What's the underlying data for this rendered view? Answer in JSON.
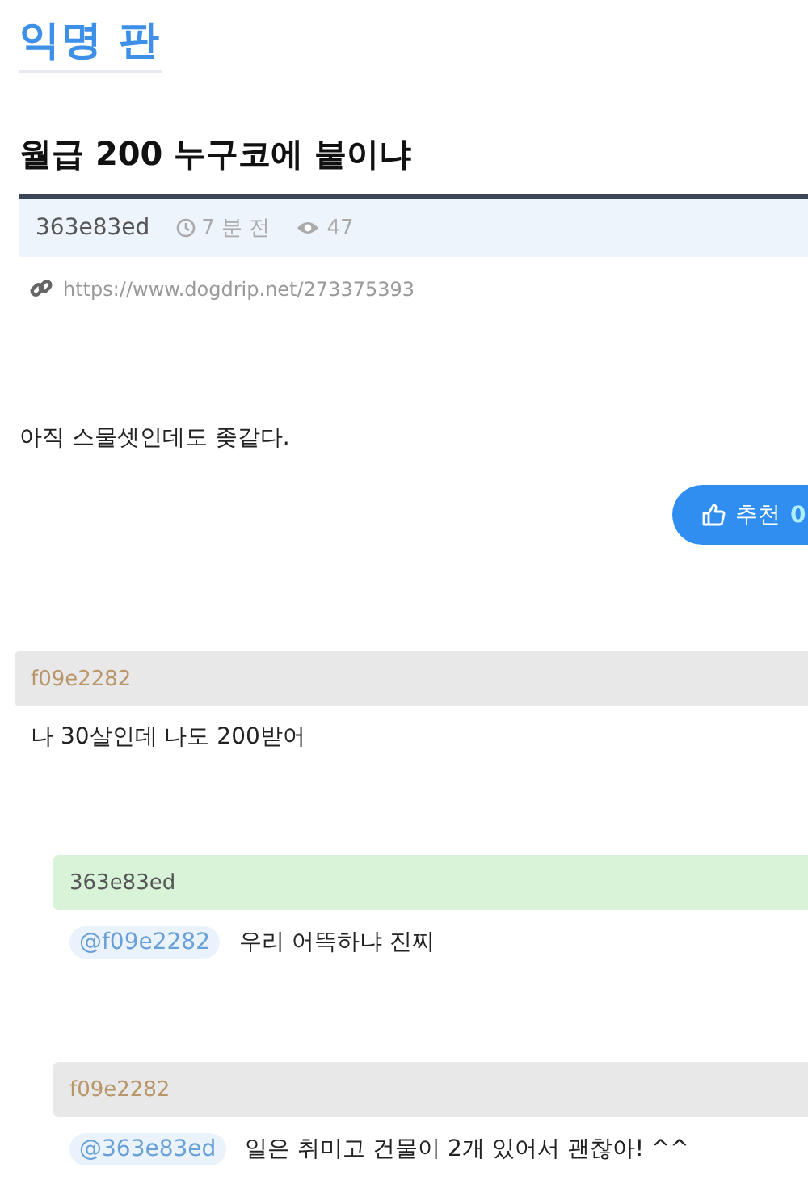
{
  "board": {
    "title": "익명 판"
  },
  "post": {
    "title": "월급 200 누구코에 붙이냐",
    "author": "363e83ed",
    "time": "7 분 전",
    "views": "47",
    "link": "https://www.dogdrip.net/273375393",
    "body": "아직 스물셋인데도 좆같다.",
    "recommend": {
      "label": "추천",
      "count": "0"
    }
  },
  "comments": [
    {
      "author": "f09e2282",
      "is_author": false,
      "text": "나 30살인데 나도 200받어",
      "children": [
        {
          "author": "363e83ed",
          "is_author": true,
          "mention": "@f09e2282",
          "text": "우리 어뜩하냐 진찌"
        },
        {
          "author": "f09e2282",
          "is_author": false,
          "mention": "@363e83ed",
          "text": "일은 취미고 건물이 2개 있어서 괜찮아! ^^"
        }
      ]
    }
  ]
}
